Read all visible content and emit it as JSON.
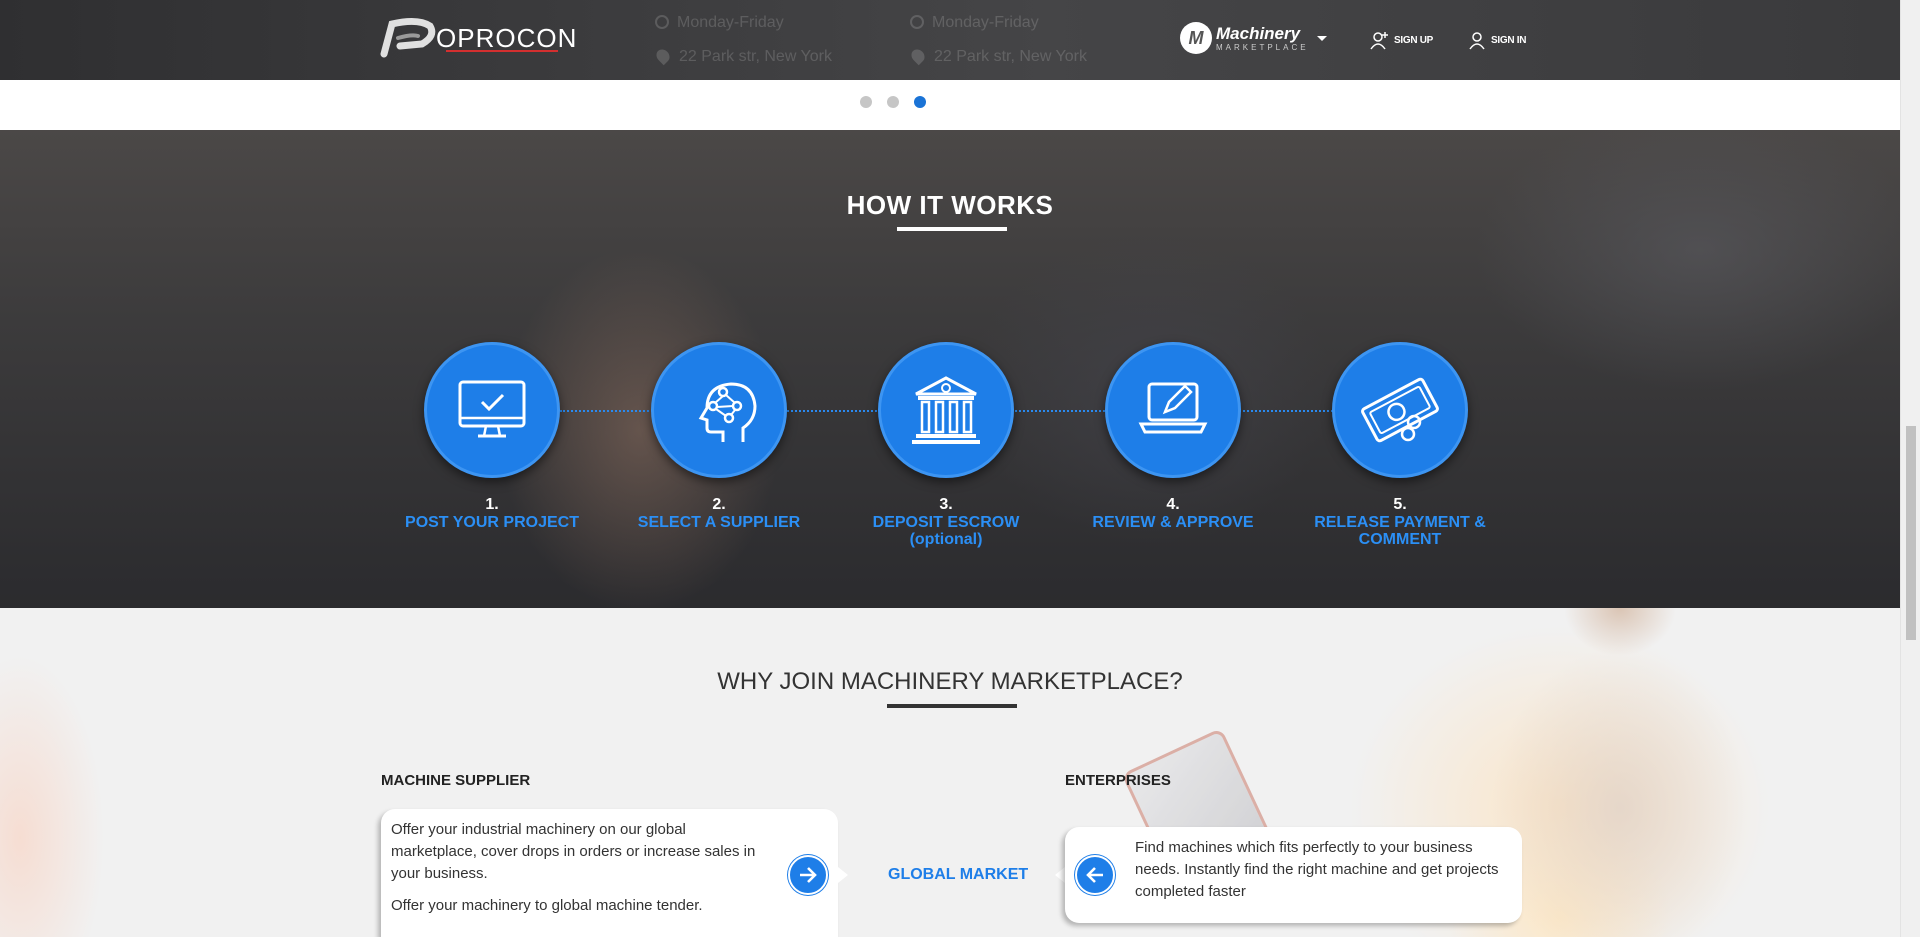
{
  "header": {
    "brand": "OPROCON",
    "ghost_hours_1": "Monday-Friday",
    "ghost_address_1": "22 Park str, New York",
    "ghost_hours_2": "Monday-Friday",
    "ghost_address_2": "22 Park str, New York",
    "marketplace_title": "Machinery",
    "marketplace_sub": "MARKETPLACE",
    "signup": "SIGN UP",
    "signin": "SIGN IN"
  },
  "carousel": {
    "dots": 3,
    "active": 3
  },
  "how": {
    "title": "HOW IT WORKS",
    "steps": [
      {
        "num": "1.",
        "label": "POST YOUR PROJECT",
        "icon": "monitor-check-icon"
      },
      {
        "num": "2.",
        "label": "SELECT A SUPPLIER",
        "icon": "head-network-icon"
      },
      {
        "num": "3.",
        "label": "DEPOSIT ESCROW",
        "sub": "(optional)",
        "icon": "bank-icon"
      },
      {
        "num": "4.",
        "label": "REVIEW & APPROVE",
        "icon": "laptop-pencil-icon"
      },
      {
        "num": "5.",
        "label": "RELEASE PAYMENT & COMMENT",
        "icon": "money-icon"
      }
    ]
  },
  "why": {
    "title": "WHY JOIN MACHINERY MARKETPLACE?",
    "supplier_heading": "MACHINE SUPPLIER",
    "supplier_text_1": "Offer your industrial machinery on our global marketplace, cover drops in orders or increase sales in your business.",
    "supplier_text_2": "Offer your machinery to global machine tender.",
    "center_label": "GLOBAL MARKET",
    "enterprise_heading": "ENTERPRISES",
    "enterprise_text": "Find machines which fits perfectly to your business needs. Instantly find the right machine and get projects completed faster"
  },
  "colors": {
    "accent": "#1e7ee8",
    "header": "#3a3a3c",
    "label": "#2b8ff5"
  }
}
